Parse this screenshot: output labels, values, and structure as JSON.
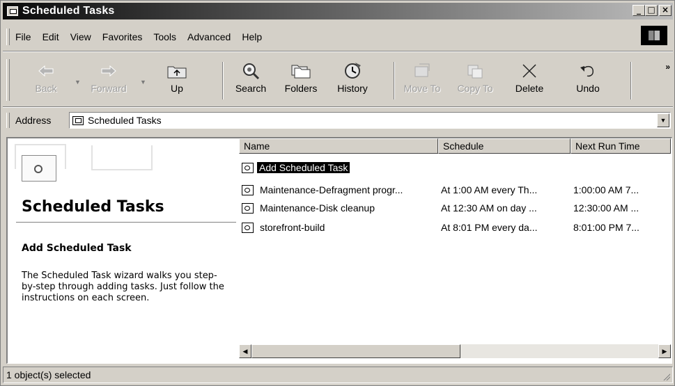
{
  "window": {
    "title": "Scheduled Tasks",
    "controls": {
      "minimize": "_",
      "maximize": "□",
      "close": "×"
    }
  },
  "menu": [
    {
      "label": "File"
    },
    {
      "label": "Edit"
    },
    {
      "label": "View"
    },
    {
      "label": "Favorites"
    },
    {
      "label": "Tools"
    },
    {
      "label": "Advanced"
    },
    {
      "label": "Help"
    }
  ],
  "toolbar": {
    "buttons": [
      {
        "label": "Back",
        "icon": "back-arrow-icon",
        "enabled": false
      },
      {
        "label": "Forward",
        "icon": "forward-arrow-icon",
        "enabled": false
      },
      {
        "label": "Up",
        "icon": "folder-up-icon",
        "enabled": true
      },
      {
        "label": "Search",
        "icon": "search-icon",
        "enabled": true
      },
      {
        "label": "Folders",
        "icon": "folders-icon",
        "enabled": true
      },
      {
        "label": "History",
        "icon": "history-icon",
        "enabled": true
      },
      {
        "label": "Move To",
        "icon": "move-to-icon",
        "enabled": false
      },
      {
        "label": "Copy To",
        "icon": "copy-to-icon",
        "enabled": false
      },
      {
        "label": "Delete",
        "icon": "delete-icon",
        "enabled": true
      },
      {
        "label": "Undo",
        "icon": "undo-icon",
        "enabled": true
      }
    ],
    "more": "»"
  },
  "address": {
    "label": "Address",
    "value": "Scheduled Tasks"
  },
  "left_pane": {
    "title": "Scheduled Tasks",
    "subtitle": "Add Scheduled Task",
    "description": "The Scheduled Task wizard walks you step-by-step through adding tasks. Just follow the instructions on each screen."
  },
  "list": {
    "columns": [
      "Name",
      "Schedule",
      "Next Run Time"
    ],
    "rows": [
      {
        "name": "Add Scheduled Task",
        "schedule": "",
        "next_run": "",
        "selected": true
      },
      {
        "name": "Maintenance-Defragment progr...",
        "schedule": "At 1:00 AM every Th...",
        "next_run": "1:00:00 AM  7...",
        "selected": false
      },
      {
        "name": "Maintenance-Disk cleanup",
        "schedule": "At 12:30 AM on day ...",
        "next_run": "12:30:00 AM  ...",
        "selected": false
      },
      {
        "name": "storefront-build",
        "schedule": "At 8:01 PM every da...",
        "next_run": "8:01:00 PM  7...",
        "selected": false
      }
    ],
    "scroll": {
      "left": "◀",
      "right": "▶"
    }
  },
  "status": {
    "text": "1 object(s) selected"
  }
}
